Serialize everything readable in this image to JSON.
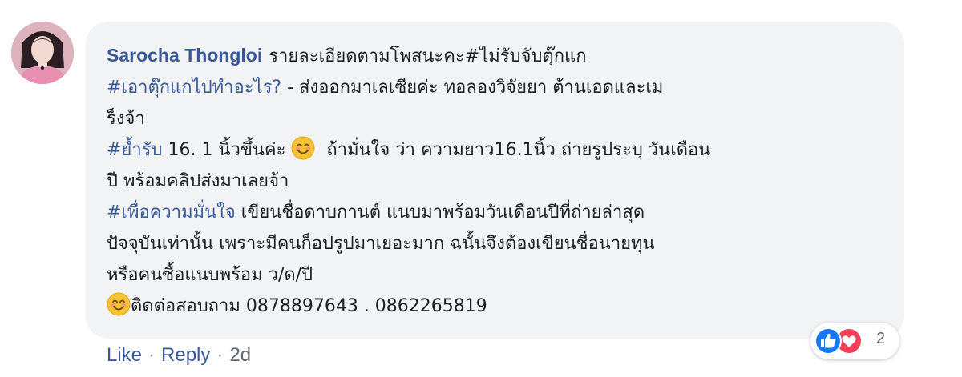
{
  "comment": {
    "author": "Sarocha Thongloi",
    "lines": [
      [
        {
          "t": "text",
          "v": "รายละเอียดตามโพสนะคะ#ไม่รับจับตุ๊กแก"
        }
      ],
      [
        {
          "t": "hashtag",
          "v": "#เอาตุ๊กแกไปทำอะไร?"
        },
        {
          "t": "text",
          "v": " - ส่งออกมาเลเซียค่ะ ทอลองวิจัยยา ต้านเอดและเม"
        }
      ],
      [
        {
          "t": "text",
          "v": "ร็งจ้า"
        }
      ],
      [
        {
          "t": "hashtag",
          "v": "#ย้ำรับ"
        },
        {
          "t": "text",
          "v": " 16. 1 นิ้วขึ้นค่ะ "
        },
        {
          "t": "emoji",
          "v": "smiling-face-emoji"
        },
        {
          "t": "text",
          "v": "  ถ้ามั่นใจ ว่า ความยาว16.1นิ้ว ถ่ายรูประบุ วันเดือน"
        }
      ],
      [
        {
          "t": "text",
          "v": "ปี พร้อมคลิปส่งมาเลยจ้า"
        }
      ],
      [
        {
          "t": "hashtag",
          "v": "#เพื่อความมั่นใจ"
        },
        {
          "t": "text",
          "v": " เขียนชื่อดาบกานต์ แนบมาพร้อมวันเดือนปีที่ถ่ายล่าสุด"
        }
      ],
      [
        {
          "t": "text",
          "v": "ปัจจุบันเท่านั้น เพราะมีคนก็อปรูปมาเยอะมาก ฉนั้นจึงต้องเขียนชื่อนายทุน"
        }
      ],
      [
        {
          "t": "text",
          "v": "หรือคนซื้อแนบพร้อม ว/ด/ปี"
        }
      ],
      [
        {
          "t": "emoji",
          "v": "smiling-face-emoji"
        },
        {
          "t": "text",
          "v": "ติดต่อสอบถาม 0878897643 . 0862265819"
        }
      ]
    ]
  },
  "reactions": {
    "icons": [
      "like-reaction-icon",
      "love-reaction-icon"
    ],
    "count": "2"
  },
  "actions": {
    "like": "Like",
    "separator": "·",
    "reply": "Reply",
    "time": "2d"
  },
  "colors": {
    "author": "#385898",
    "hashtag": "#385898",
    "bubble": "#f2f3f5",
    "text": "#1c1e21",
    "meta": "#606770",
    "like_blue": "#1877f2",
    "love_red": "#f33e58"
  }
}
